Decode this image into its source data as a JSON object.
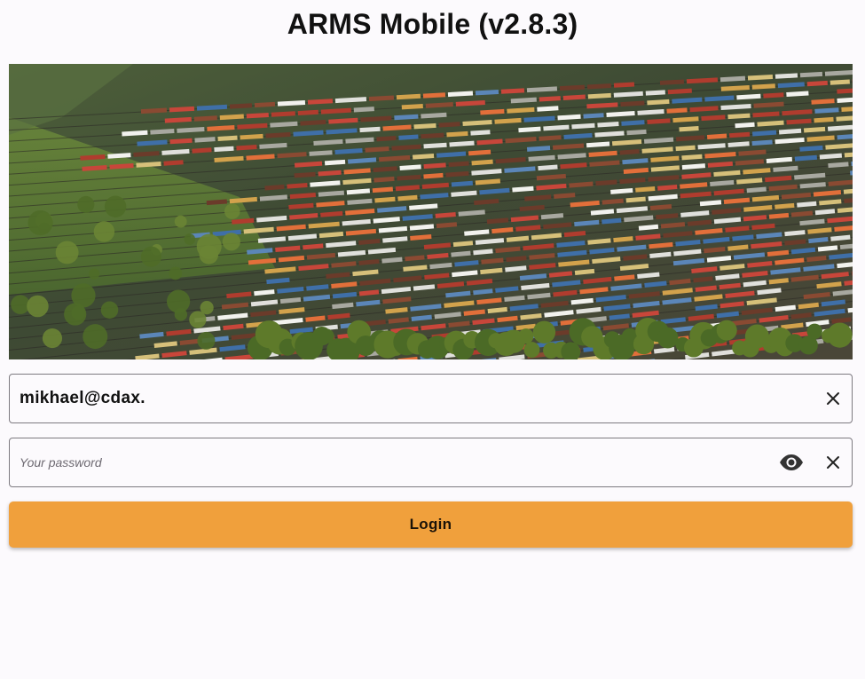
{
  "app": {
    "title": "ARMS Mobile (v2.8.3)"
  },
  "hero": {
    "icon": "rail-yard-aerial-photo"
  },
  "login_form": {
    "email": {
      "value": "mikhael@cdax.",
      "clear_icon": "close-icon"
    },
    "password": {
      "value": "",
      "placeholder": "Your password",
      "visibility_icon": "eye-icon",
      "clear_icon": "close-icon"
    },
    "login_button": {
      "label": "Login",
      "color": "#f0a03c"
    }
  },
  "colors": {
    "background": "#fcfafd",
    "field_border": "#7d7a80",
    "accent": "#f0a03c"
  }
}
